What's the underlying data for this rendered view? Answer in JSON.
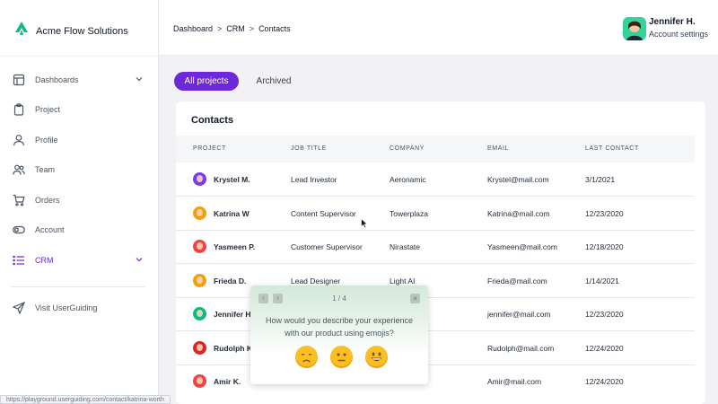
{
  "brand": {
    "name": "Acme Flow Solutions"
  },
  "sidebar": {
    "items": [
      {
        "label": "Dashboards",
        "icon": "layout-icon",
        "chevron": true
      },
      {
        "label": "Project",
        "icon": "clipboard-icon"
      },
      {
        "label": "Profile",
        "icon": "user-icon"
      },
      {
        "label": "Team",
        "icon": "users-icon"
      },
      {
        "label": "Orders",
        "icon": "cart-icon"
      },
      {
        "label": "Account",
        "icon": "toggle-icon"
      },
      {
        "label": "CRM",
        "icon": "list-icon",
        "chevron": true,
        "active": true
      }
    ],
    "visit": {
      "label": "Visit UserGuiding",
      "icon": "send-icon"
    }
  },
  "header": {
    "breadcrumb": [
      "Dashboard",
      "CRM",
      "Contacts"
    ],
    "user": {
      "name": "Jennifer H.",
      "subtitle": "Account settings"
    }
  },
  "tabs": {
    "active": "All projects",
    "archived": "Archived"
  },
  "contacts": {
    "title": "Contacts",
    "columns": [
      "PROJECT",
      "JOB TITLE",
      "COMPANY",
      "EMAIL",
      "LAST CONTACT"
    ],
    "rows": [
      {
        "name": "Krystel M.",
        "job": "Lead Investor",
        "company": "Aeronamic",
        "email": "Krystel@mail.com",
        "last": "3/1/2021",
        "avatar": "#7c3aed"
      },
      {
        "name": "Katrina W",
        "job": "Content Supervisor",
        "company": "Towerplaza",
        "email": "Katrina@mail.com",
        "last": "12/23/2020",
        "avatar": "#f59e0b"
      },
      {
        "name": "Yasmeen P.",
        "job": "Customer Supervisor",
        "company": "Nirastate",
        "email": "Yasmeen@mail.com",
        "last": "12/18/2020",
        "avatar": "#ef4444"
      },
      {
        "name": "Frieda D.",
        "job": "Lead Designer",
        "company": "Light AI",
        "email": "Frieda@mail.com",
        "last": "1/14/2021",
        "avatar": "#f59e0b"
      },
      {
        "name": "Jennifer H.",
        "job": "",
        "company": "",
        "email": "jennifer@mail.com",
        "last": "12/23/2020",
        "avatar": "#10b981"
      },
      {
        "name": "Rudolph K.",
        "job": "",
        "company": "",
        "email": "Rudolph@mail.com",
        "last": "12/24/2020",
        "avatar": "#dc2626"
      },
      {
        "name": "Amir K.",
        "job": "",
        "company": "",
        "email": "Amir@mail.com",
        "last": "12/24/2020",
        "avatar": "#ef4444"
      }
    ]
  },
  "survey": {
    "page": "1 / 4",
    "question": "How would you describe your experience with our product using emojis?",
    "emojis": [
      "sad-face-icon",
      "neutral-face-icon",
      "happy-face-icon"
    ]
  },
  "status_url": "https://playground.userguiding.com/contact/katrina-worth"
}
